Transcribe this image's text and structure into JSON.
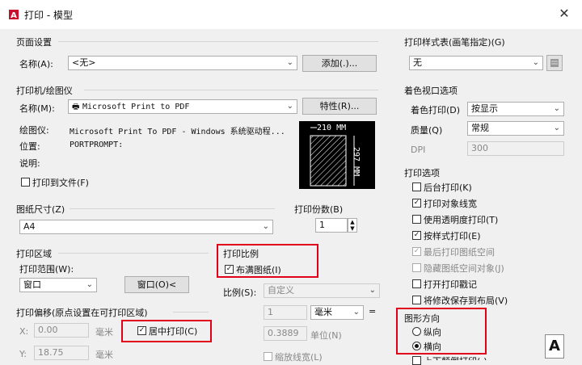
{
  "window": {
    "title": "打印 - 模型",
    "close": "✕"
  },
  "page_setup": {
    "section": "页面设置",
    "name_label": "名称(A):",
    "name_value": "<无>",
    "add_button": "添加(.)..."
  },
  "printer": {
    "section": "打印机/绘图仪",
    "name_label": "名称(M):",
    "name_value": "Microsoft Print to PDF",
    "properties_button": "特性(R)...",
    "plotter_label": "绘图仪:",
    "plotter_value": "Microsoft Print To PDF - Windows 系统驱动程...",
    "location_label": "位置:",
    "location_value": "PORTPROMPT:",
    "desc_label": "说明:",
    "print_to_file": "打印到文件(F)",
    "preview_width": "210 MM",
    "preview_height": "297 MM"
  },
  "paper": {
    "section": "图纸尺寸(Z)",
    "value": "A4"
  },
  "copies": {
    "label": "打印份数(B)",
    "value": "1"
  },
  "plot_area": {
    "section": "打印区域",
    "range_label": "打印范围(W):",
    "range_value": "窗口",
    "window_button": "窗口(O)<"
  },
  "offset": {
    "section": "打印偏移(原点设置在可打印区域)",
    "x_label": "X:",
    "x_value": "0.00",
    "x_unit": "毫米",
    "y_label": "Y:",
    "y_value": "18.75",
    "y_unit": "毫米",
    "center_plot": "居中打印(C)"
  },
  "scale": {
    "section": "打印比例",
    "fit_paper": "布满图纸(I)",
    "ratio_label": "比例(S):",
    "ratio_value": "自定义",
    "value1": "1",
    "unit1": "毫米",
    "equals": "=",
    "value2": "0.3889",
    "unit2": "单位(N)",
    "scale_lineweights": "缩放线宽(L)"
  },
  "style_table": {
    "section": "打印样式表(画笔指定)(G)",
    "value": "无"
  },
  "shaded": {
    "section": "着色视口选项",
    "shade_label": "着色打印(D)",
    "shade_value": "按显示",
    "quality_label": "质量(Q)",
    "quality_value": "常规",
    "dpi_label": "DPI",
    "dpi_value": "300"
  },
  "options": {
    "section": "打印选项",
    "items": [
      {
        "label": "后台打印(K)",
        "checked": false,
        "disabled": false
      },
      {
        "label": "打印对象线宽",
        "checked": true,
        "disabled": false
      },
      {
        "label": "使用透明度打印(T)",
        "checked": false,
        "disabled": false
      },
      {
        "label": "按样式打印(E)",
        "checked": true,
        "disabled": false
      },
      {
        "label": "最后打印图纸空间",
        "checked": true,
        "disabled": true
      },
      {
        "label": "隐藏图纸空间对象(J)",
        "checked": false,
        "disabled": true
      },
      {
        "label": "打开打印戳记",
        "checked": false,
        "disabled": false
      },
      {
        "label": "将修改保存到布局(V)",
        "checked": false,
        "disabled": false
      }
    ],
    "partial_next": "上下颠倒打印(-)"
  },
  "orientation": {
    "section": "图形方向",
    "portrait": "纵向",
    "landscape": "横向",
    "selected": "landscape"
  },
  "expand_button": "<"
}
